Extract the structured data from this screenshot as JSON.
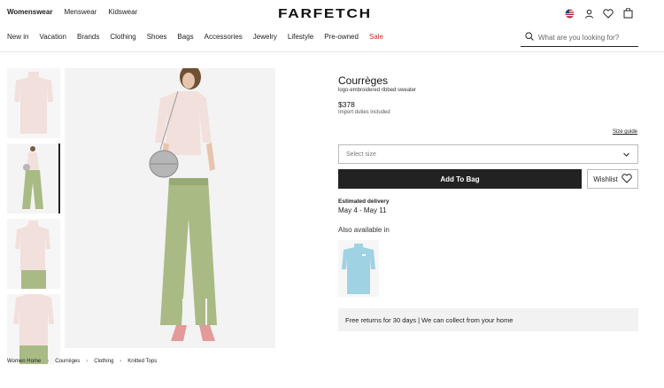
{
  "header": {
    "gender_tabs": [
      "Womenswear",
      "Menswear",
      "Kidswear"
    ],
    "logo": "FARFETCH",
    "icons": [
      "flag-icon",
      "account-icon",
      "wishlist-icon",
      "bag-icon"
    ]
  },
  "nav": {
    "items": [
      "New in",
      "Vacation",
      "Brands",
      "Clothing",
      "Shoes",
      "Bags",
      "Accessories",
      "Jewelry",
      "Lifestyle",
      "Pre-owned"
    ],
    "sale": "Sale",
    "sale_color": "#c8322b"
  },
  "search": {
    "placeholder": "What are you looking for?"
  },
  "product": {
    "brand": "Courrèges",
    "description": "logo-embroidered ribbed sweater",
    "price": "$378",
    "duties": "Import duties included",
    "size_guide": "Size guide",
    "size_select": "Select size",
    "add_to_bag": "Add To Bag",
    "wishlist": "Wishlist",
    "delivery_label": "Estimated delivery",
    "delivery_dates": "May 4 - May 11",
    "also_available": "Also available in",
    "returns": "Free returns for 30 days | We can collect from your home"
  },
  "breadcrumb": [
    "Women Home",
    "Courrèges",
    "Clothing",
    "Knitted Tops"
  ],
  "colors": {
    "accent": "#222222",
    "sweater": "#f2e0dd",
    "trousers": "#a9ba85",
    "alt_sweater": "#9fd3e3"
  }
}
